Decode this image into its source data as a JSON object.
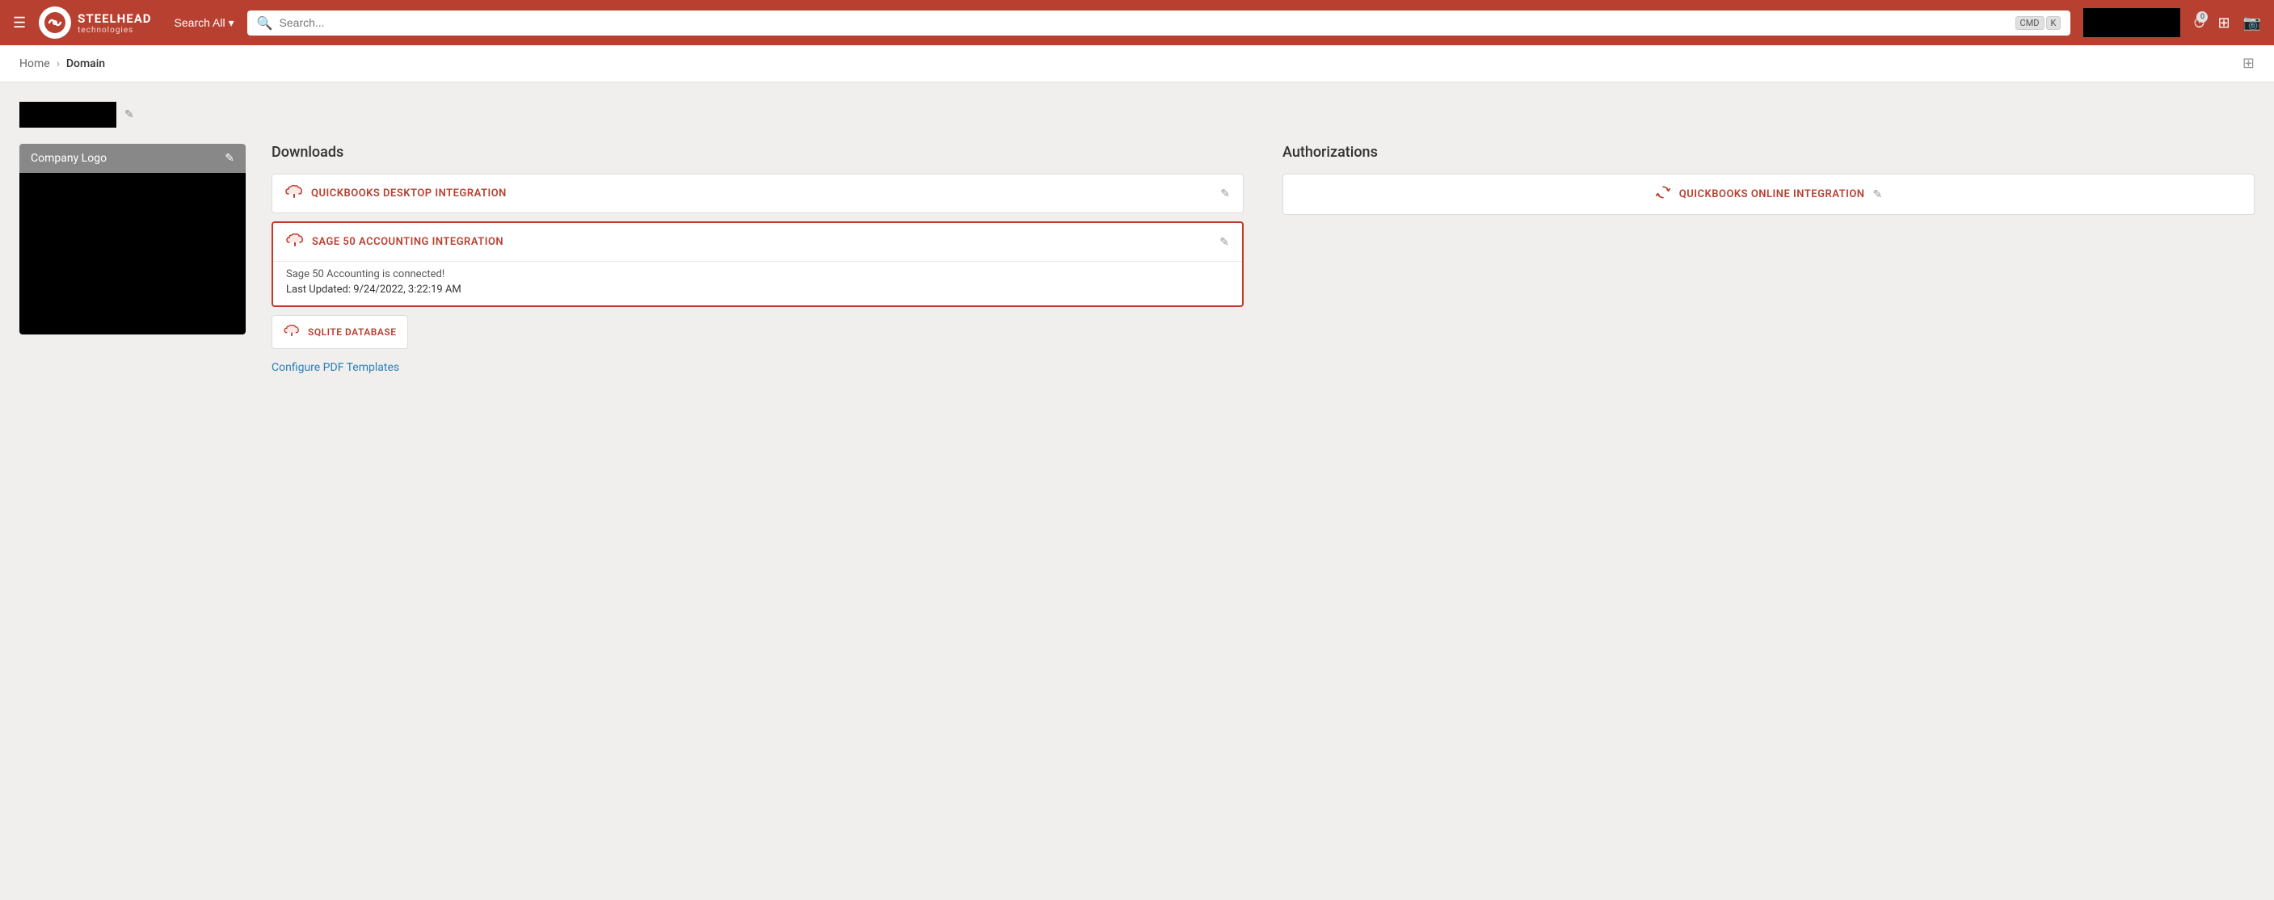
{
  "header": {
    "menu_icon": "☰",
    "logo_letters": "ST",
    "logo_name": "STEELHEAD",
    "logo_sub": "technologies",
    "search_all_label": "Search All",
    "search_placeholder": "Search...",
    "kbd1": "CMD",
    "kbd2": "K",
    "badge_count": "0"
  },
  "breadcrumb": {
    "home": "Home",
    "separator": "›",
    "current": "Domain"
  },
  "company": {
    "edit_icon": "✎"
  },
  "company_logo": {
    "label": "Company Logo",
    "edit_icon": "✎"
  },
  "downloads": {
    "title": "Downloads",
    "quickbooks_desktop": {
      "label": "QUICKBOOKS DESKTOP INTEGRATION",
      "cloud_icon": "☁",
      "pencil_icon": "✎"
    },
    "sage50": {
      "label": "SAGE 50 ACCOUNTING INTEGRATION",
      "cloud_icon": "☁",
      "pencil_icon": "✎",
      "connected_text": "Sage 50 Accounting is connected!",
      "updated_text": "Last Updated: 9/24/2022, 3:22:19 AM"
    },
    "sqlite": {
      "label": "SQLITE DATABASE",
      "cloud_icon": "☁"
    },
    "configure_link": "Configure PDF Templates"
  },
  "authorizations": {
    "title": "Authorizations",
    "quickbooks_online": {
      "label": "QUICKBOOKS ONLINE INTEGRATION",
      "sync_icon": "↻",
      "pencil_icon": "✎"
    }
  }
}
